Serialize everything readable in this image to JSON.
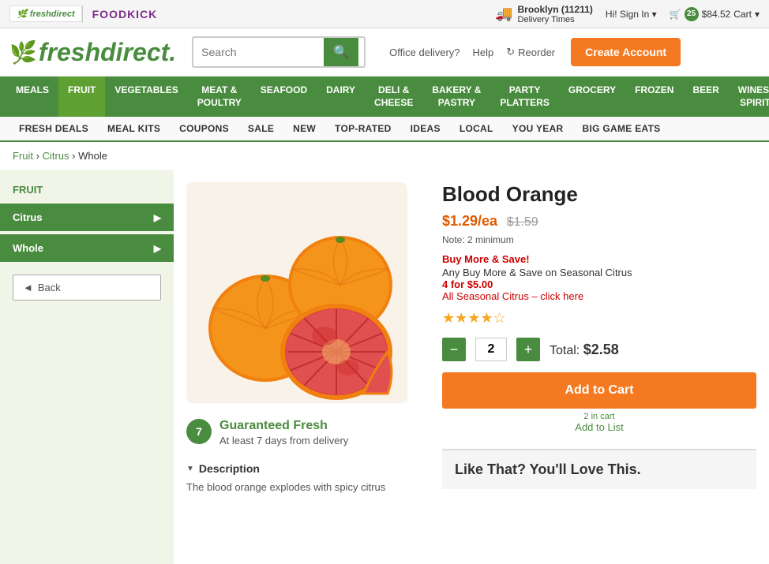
{
  "topbar": {
    "logo_fd": "freshdirect",
    "logo_foodkick": "FOODKICK",
    "location": "Brooklyn (11211)",
    "delivery_label": "Delivery Times",
    "greeting": "Hi!",
    "signin": "Sign In",
    "cart_count": "25",
    "cart_total": "$84.52",
    "cart_label": "Cart"
  },
  "header": {
    "logo": "freshdirect.",
    "search_placeholder": "Search",
    "search_btn_label": "🔍",
    "office_delivery": "Office delivery?",
    "help": "Help",
    "reorder": "Reorder",
    "create_account": "Create Account"
  },
  "main_nav": [
    {
      "label": "MEALS"
    },
    {
      "label": "FRUIT"
    },
    {
      "label": "VEGETABLES"
    },
    {
      "label": "MEAT &\nPOULTRY"
    },
    {
      "label": "SEAFOOD"
    },
    {
      "label": "DAIRY"
    },
    {
      "label": "DELI &\nCHEESE"
    },
    {
      "label": "BAKERY &\nPASTRY"
    },
    {
      "label": "PARTY\nPLATTERS"
    },
    {
      "label": "GROCERY"
    },
    {
      "label": "FROZEN"
    },
    {
      "label": "BEER"
    },
    {
      "label": "WINES &\nSPIRITS"
    }
  ],
  "secondary_nav": [
    "FRESH DEALS",
    "MEAL KITS",
    "COUPONS",
    "SALE",
    "NEW",
    "TOP-RATED",
    "IDEAS",
    "LOCAL",
    "YOU YEAR",
    "BIG GAME EATS"
  ],
  "breadcrumb": {
    "items": [
      "Fruit",
      "Citrus",
      "Whole"
    ]
  },
  "sidebar": {
    "title": "FRUIT",
    "items": [
      {
        "label": "Citrus",
        "active": true
      },
      {
        "label": "Whole",
        "active": true
      }
    ],
    "back_label": "Back"
  },
  "product": {
    "name": "Blood Orange",
    "price": "$1.29/ea",
    "price_old": "$1.59",
    "note": "Note: 2 minimum",
    "promo_headline": "Buy More & Save!",
    "promo_detail": "Any Buy More & Save on Seasonal Citrus",
    "promo_deal": "4 for $5.00",
    "promo_link": "All Seasonal Citrus – click here",
    "stars": "★★★★☆",
    "qty": "2",
    "total_label": "Total:",
    "total_value": "$2.58",
    "add_cart": "Add to Cart",
    "in_cart": "2 in cart",
    "add_list": "Add to List",
    "fresh_badge": "7",
    "fresh_title": "Guaranteed Fresh",
    "fresh_subtitle": "At least 7 days from delivery",
    "desc_title": "Description",
    "desc_text": "The blood orange explodes with spicy citrus"
  },
  "love_section": {
    "title": "Like That? You'll Love This."
  }
}
